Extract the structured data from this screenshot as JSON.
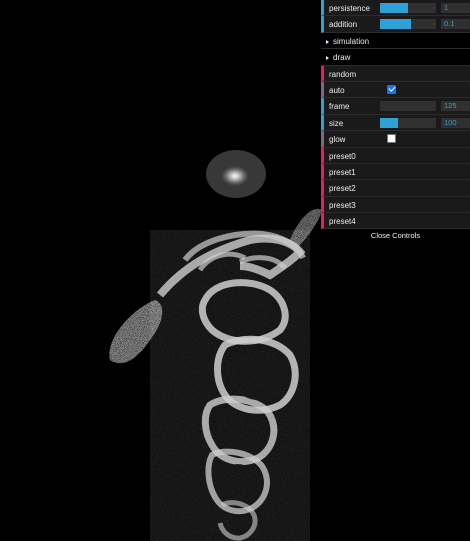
{
  "controls": {
    "persistence": {
      "label": "persistence",
      "value": "1",
      "level": 0.5
    },
    "addition": {
      "label": "addition",
      "value": "0.1",
      "level": 0.55
    },
    "folders": {
      "simulation": "simulation",
      "draw": "draw"
    },
    "random": {
      "label": "random"
    },
    "auto": {
      "label": "auto",
      "checked": true
    },
    "frame": {
      "label": "frame",
      "value": "125",
      "level": 0.0
    },
    "size": {
      "label": "size",
      "value": "100",
      "level": 0.33
    },
    "glow": {
      "label": "glow",
      "checked": false
    },
    "presets": [
      "preset0",
      "preset1",
      "preset2",
      "preset3",
      "preset4"
    ],
    "close_label": "Close Controls"
  },
  "colors": {
    "number_accent": "#2fa1d6",
    "function_accent": "#e61d5f",
    "bool_accent": "#806787",
    "panel_bg": "#1a1a1a"
  }
}
